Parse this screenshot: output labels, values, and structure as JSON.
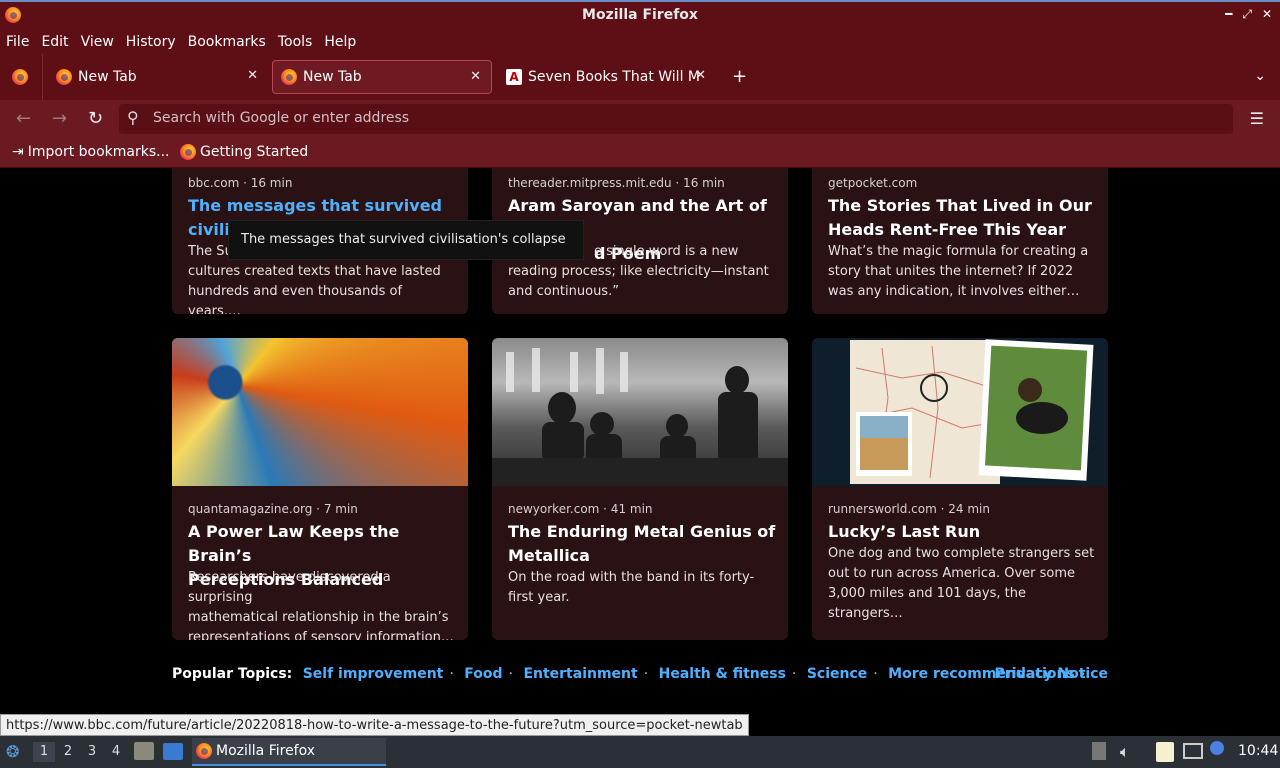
{
  "window": {
    "title": "Mozilla Firefox"
  },
  "menu": [
    "File",
    "Edit",
    "View",
    "History",
    "Bookmarks",
    "Tools",
    "Help"
  ],
  "tabs": [
    {
      "label": "New Tab",
      "active": false
    },
    {
      "label": "New Tab",
      "active": true
    },
    {
      "label": "Seven Books That Will Ma",
      "active": false
    }
  ],
  "urlbar": {
    "placeholder": "Search with Google or enter address"
  },
  "bookmarks": [
    {
      "label": "Import bookmarks..."
    },
    {
      "label": "Getting Started"
    }
  ],
  "cards": [
    {
      "source": "bbc.com · 16 min",
      "headline_line1": "The messages that survived",
      "headline_line2": "civili",
      "excerpt_line1": "The Su",
      "excerpt_line2": "cultures created texts that have lasted",
      "excerpt_line3": "hundreds and even thousands of years.…",
      "tooltip": "The messages that survived civilisation's collapse"
    },
    {
      "source": "thereader.mitpress.mit.edu · 16 min",
      "headline_line1": "Aram Saroyan and the Art of the",
      "headline_line2": "d Poem",
      "excerpt_line1": "e single word is a new",
      "excerpt_line2": "reading process; like electricity—instant",
      "excerpt_line3": "and continuous.”"
    },
    {
      "source": "getpocket.com",
      "headline_line1": "The Stories That Lived in Our",
      "headline_line2": "Heads Rent-Free This Year",
      "excerpt_line1": "What’s the magic formula for creating a",
      "excerpt_line2": "story that unites the internet? If 2022",
      "excerpt_line3": "was any indication, it involves either…"
    },
    {
      "source": "quantamagazine.org · 7 min",
      "headline_line1": "A Power Law Keeps the Brain’s",
      "headline_line2": "Perceptions Balanced",
      "excerpt_line1": "Researchers have discovered a surprising",
      "excerpt_line2": "mathematical relationship in the brain’s",
      "excerpt_line3": "representations of sensory information…"
    },
    {
      "source": "newyorker.com · 41 min",
      "headline_line1": "The Enduring Metal Genius of",
      "headline_line2": "Metallica",
      "excerpt_line1": "On the road with the band in its forty-",
      "excerpt_line2": "first year."
    },
    {
      "source": "runnersworld.com · 24 min",
      "headline_line1": "Lucky’s Last Run",
      "excerpt_line1": "One dog and two complete strangers set",
      "excerpt_line2": "out to run across America. Over some",
      "excerpt_line3": "3,000 miles and 101 days, the strangers…"
    }
  ],
  "topics": {
    "label": "Popular Topics:",
    "items": [
      "Self improvement",
      "Food",
      "Entertainment",
      "Health & fitness",
      "Science"
    ],
    "more": "More recommendations ›",
    "privacy": "Privacy Notice"
  },
  "status_url": "https://www.bbc.com/future/article/20220818-how-to-write-a-message-to-the-future?utm_source=pocket-newtab",
  "taskbar": {
    "workspaces": [
      "1",
      "2",
      "3",
      "4"
    ],
    "window_label": "Mozilla Firefox",
    "clock": "10:44"
  }
}
